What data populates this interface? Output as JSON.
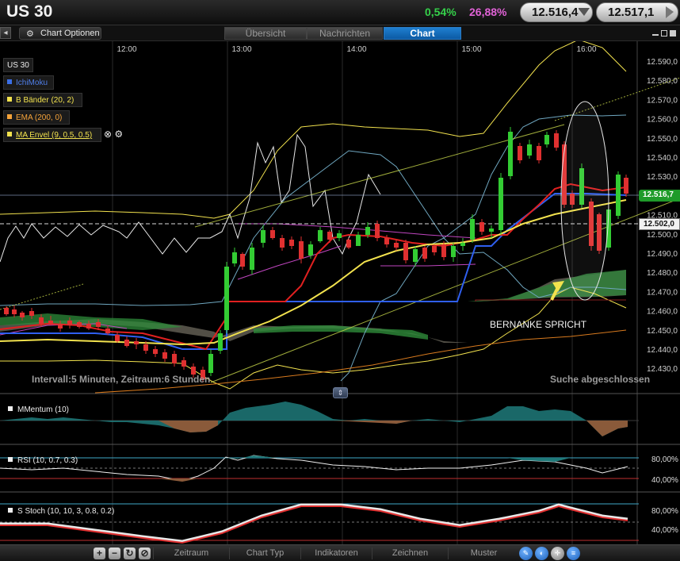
{
  "header": {
    "symbol": "US 30",
    "change_pct": "0,54%",
    "change_pct2": "26,88%",
    "bid_price": "12.516,4",
    "ask_price": "12.517,1"
  },
  "toolbar": {
    "back_icon": "arrow-left-icon",
    "chart_options_label": "Chart Optionen",
    "tabs": [
      {
        "label": "Übersicht",
        "active": false
      },
      {
        "label": "Nachrichten",
        "active": false
      },
      {
        "label": "Chart",
        "active": true
      }
    ]
  },
  "chart": {
    "time_labels": [
      "12:00",
      "13:00",
      "14:00",
      "15:00",
      "16:00"
    ],
    "price_labels": [
      "12.590,0",
      "12.580,0",
      "12.570,0",
      "12.560,0",
      "12.550,0",
      "12.540,0",
      "12.530,0",
      "12.520,0",
      "12.510,0",
      "12.500,0",
      "12.490,0",
      "12.480,0",
      "12.470,0",
      "12.460,0",
      "12.450,0",
      "12.440,0",
      "12.430,0"
    ],
    "current_price_tag": "12.516,7",
    "ref_price_tag": "12.502,0",
    "legend": [
      {
        "label": "US 30",
        "color": "#ffffff"
      },
      {
        "label": "IchiMoku",
        "color": "#3b6fe6"
      },
      {
        "label": "B Bänder (20, 2)",
        "color": "#f2e24e"
      },
      {
        "label": "EMA (200, 0)",
        "color": "#f5a33a"
      },
      {
        "label": "MA Envel (9, 0.5, 0.5)",
        "color": "#f2e24e"
      }
    ],
    "interval_info": "Intervall:5 Minuten, Zeitraum:6 Stunden",
    "search_status": "Suche abgeschlossen",
    "annotation": "BERNANKE SPRICHT"
  },
  "indicators": {
    "momentum_label": "MMentum (10)",
    "rsi_label": "RSI (10, 0.7, 0.3)",
    "rsi_levels": [
      "80,00%",
      "40,00%"
    ],
    "stoch_label": "S Stoch (10, 10, 3, 0.8, 0.2)",
    "stoch_levels": [
      "80,00%",
      "40,00%"
    ]
  },
  "bottom_toolbar": {
    "menus": [
      "Zeitraum",
      "Chart Typ",
      "Indikatoren",
      "Zeichnen",
      "Muster"
    ],
    "icons": [
      "zoom-in-icon",
      "zoom-out-icon",
      "refresh-icon",
      "reset-icon",
      "pencil-icon",
      "color-icon",
      "crosshair-icon",
      "data-icon"
    ]
  },
  "colors": {
    "up": "#33cc33",
    "down": "#e03030",
    "ichimoku_blue": "#2f5ff0",
    "bollinger": "#f2e24e",
    "accent_tab": "#1f7fd0"
  }
}
